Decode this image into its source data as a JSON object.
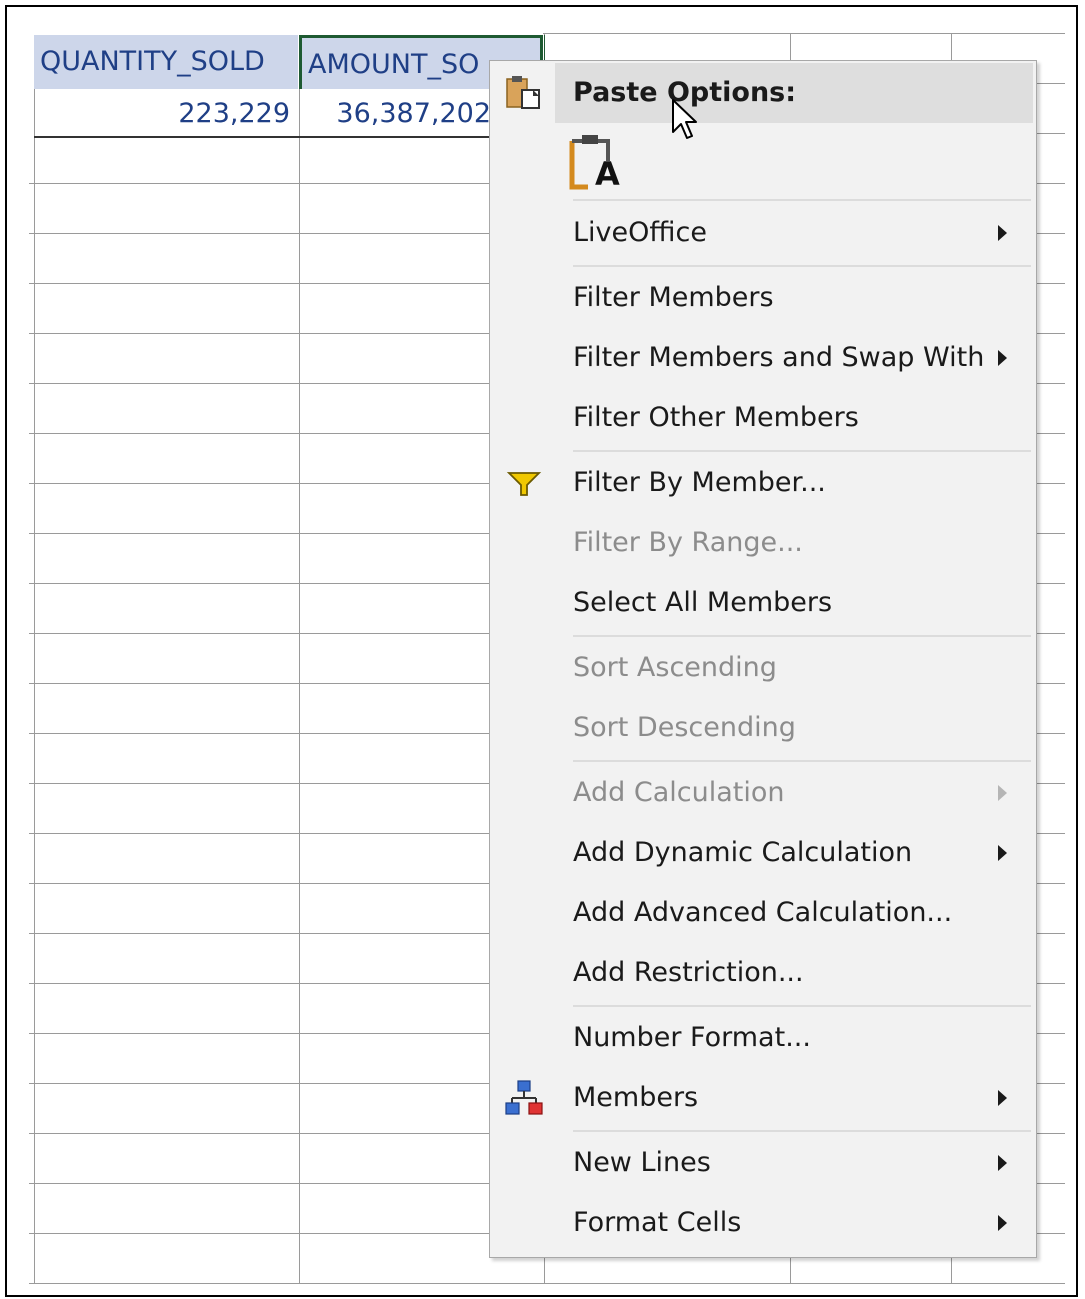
{
  "sheet": {
    "headers": [
      "QUANTITY_SOLD",
      "AMOUNT_SO"
    ],
    "values": [
      "223,229",
      "36,387,202"
    ]
  },
  "menu": {
    "paste_options_label": "Paste Options:",
    "paste_text_icon_letter": "A",
    "items": {
      "liveoffice": "LiveOffice",
      "filter_members": "Filter Members",
      "filter_members_swap": "Filter Members and Swap With",
      "filter_other": "Filter Other Members",
      "filter_by_member": "Filter By Member...",
      "filter_by_range": "Filter By Range...",
      "select_all": "Select All Members",
      "sort_asc": "Sort Ascending",
      "sort_desc": "Sort Descending",
      "add_calc": "Add Calculation",
      "add_dynamic_calc": "Add Dynamic Calculation",
      "add_advanced_calc": "Add Advanced Calculation...",
      "add_restriction": "Add Restriction...",
      "number_format": "Number Format...",
      "members": "Members",
      "new_lines": "New Lines",
      "format_cells": "Format Cells"
    }
  },
  "colors": {
    "header_fill": "#cdd6ea",
    "header_text": "#1f3f86",
    "selection_border": "#1e5a32",
    "filter_icon": "#f0c800"
  }
}
